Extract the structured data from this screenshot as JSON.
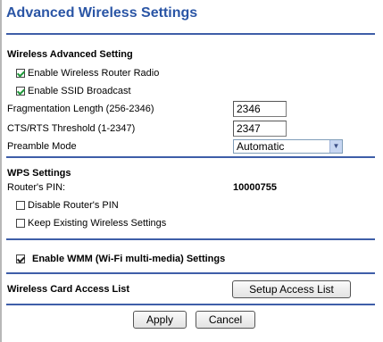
{
  "page": {
    "title": "Advanced Wireless Settings"
  },
  "wireless_advanced": {
    "heading": "Wireless Advanced Setting",
    "enable_radio_label": "Enable Wireless Router Radio",
    "enable_radio_checked": true,
    "enable_ssid_label": "Enable SSID Broadcast",
    "enable_ssid_checked": true,
    "frag_label": "Fragmentation Length (256-2346)",
    "frag_value": "2346",
    "rts_label": "CTS/RTS Threshold (1-2347)",
    "rts_value": "2347",
    "preamble_label": "Preamble Mode",
    "preamble_value": "Automatic"
  },
  "wps": {
    "heading": "WPS Settings",
    "pin_label": "Router's PIN:",
    "pin_value": "10000755",
    "disable_pin_label": "Disable Router's PIN",
    "disable_pin_checked": false,
    "keep_existing_label": "Keep Existing Wireless Settings",
    "keep_existing_checked": false
  },
  "wmm": {
    "label": "Enable WMM (Wi-Fi multi-media) Settings",
    "checked": true
  },
  "access_list": {
    "label": "Wireless Card Access List",
    "button_label": "Setup Access List"
  },
  "actions": {
    "apply_label": "Apply",
    "cancel_label": "Cancel"
  }
}
